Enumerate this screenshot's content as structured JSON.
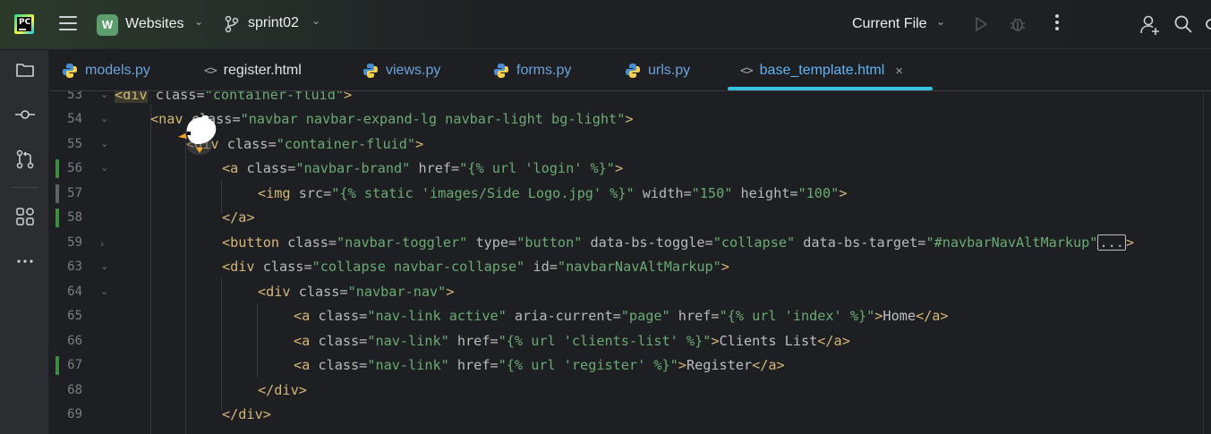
{
  "titlebar": {
    "app_logo_text": "PC",
    "project_badge": "W",
    "project_name": "Websites",
    "branch_name": "sprint02",
    "run_config": "Current File"
  },
  "tabs": [
    {
      "label": "models.py",
      "type": "python"
    },
    {
      "label": "register.html",
      "type": "html"
    },
    {
      "label": "views.py",
      "type": "python"
    },
    {
      "label": "forms.py",
      "type": "python"
    },
    {
      "label": "urls.py",
      "type": "python"
    },
    {
      "label": "base_template.html",
      "type": "html",
      "active": true,
      "close": "×"
    }
  ],
  "editor": {
    "line_numbers": [
      "53",
      "54",
      "55",
      "56",
      "57",
      "58",
      "59",
      "63",
      "64",
      "65",
      "66",
      "67",
      "68",
      "69"
    ],
    "lines": {
      "l53": {
        "t1": "<div",
        "a1": " class=",
        "v1": "\"container-fluid\"",
        "t2": ">"
      },
      "l54": {
        "t1": "<nav",
        "a1": " class=",
        "v1": "\"navbar navbar-expand-lg navbar-light bg-light\"",
        "t2": ">"
      },
      "l55": {
        "t1": "<div",
        "a1": " class=",
        "v1": "\"container-fluid\"",
        "t2": ">"
      },
      "l56": {
        "t1": "<a",
        "a1": " class=",
        "v1": "\"navbar-brand\"",
        "a2": " href=",
        "v2": "\"{% url 'login' %}\"",
        "t2": ">"
      },
      "l57": {
        "t1": "<img",
        "a1": " src=",
        "v1": "\"{% static 'images/Side Logo.jpg' %}\"",
        "a2": " width=",
        "v2": "\"150\"",
        "a3": " height=",
        "v3": "\"100\"",
        "t2": ">"
      },
      "l58": {
        "t1": "</a>"
      },
      "l59": {
        "t1": "<button",
        "a1": " class=",
        "v1": "\"navbar-toggler\"",
        "a2": " type=",
        "v2": "\"button\"",
        "a3": " data-bs-toggle=",
        "v3": "\"collapse\"",
        "a4": " data-bs-target=",
        "v4": "\"#navbarNavAltMarkup\"",
        "box": "...",
        "t2": ">"
      },
      "l63": {
        "t1": "<div",
        "a1": " class=",
        "v1": "\"collapse navbar-collapse\"",
        "a2": " id=",
        "v2": "\"navbarNavAltMarkup\"",
        "t2": ">"
      },
      "l64": {
        "t1": "<div",
        "a1": " class=",
        "v1": "\"navbar-nav\"",
        "t2": ">"
      },
      "l65": {
        "t1": "<a",
        "a1": " class=",
        "v1": "\"nav-link active\"",
        "a2": " aria-current=",
        "v2": "\"page\"",
        "a3": " href=",
        "v3": "\"{% url 'index' %}\"",
        "t2": ">",
        "text": "Home",
        "t3": "</a>"
      },
      "l66": {
        "t1": "<a",
        "a1": " class=",
        "v1": "\"nav-link\"",
        "a2": " href=",
        "v2": "\"{% url 'clients-list' %}\"",
        "t2": ">",
        "text": "Clients List",
        "t3": "</a>"
      },
      "l67": {
        "t1": "<a",
        "a1": " class=",
        "v1": "\"nav-link\"",
        "a2": " href=",
        "v2": "\"{% url 'register' %}\"",
        "t2": ">",
        "text": "Register",
        "t3": "</a>"
      },
      "l68": {
        "t1": "</div>"
      },
      "l69": {
        "t1": "</div>"
      }
    }
  },
  "colors": {
    "background": "#1e1f22",
    "tag": "#d5b778",
    "attribute": "#bababa",
    "string": "#6aab73",
    "vcs_added": "#3f8e3f",
    "vcs_modified": "#606366",
    "active_tab_underline": "#36c2e3"
  },
  "icons": {
    "toolstrip": [
      "folder-icon",
      "commit-icon",
      "pull-requests-icon",
      "plugins-icon",
      "more-tools-icon"
    ],
    "titlebar": [
      "hamburger-menu-icon",
      "branch-icon",
      "run-icon",
      "debug-icon",
      "more-actions-icon",
      "add-user-icon",
      "search-icon",
      "settings-icon"
    ]
  }
}
